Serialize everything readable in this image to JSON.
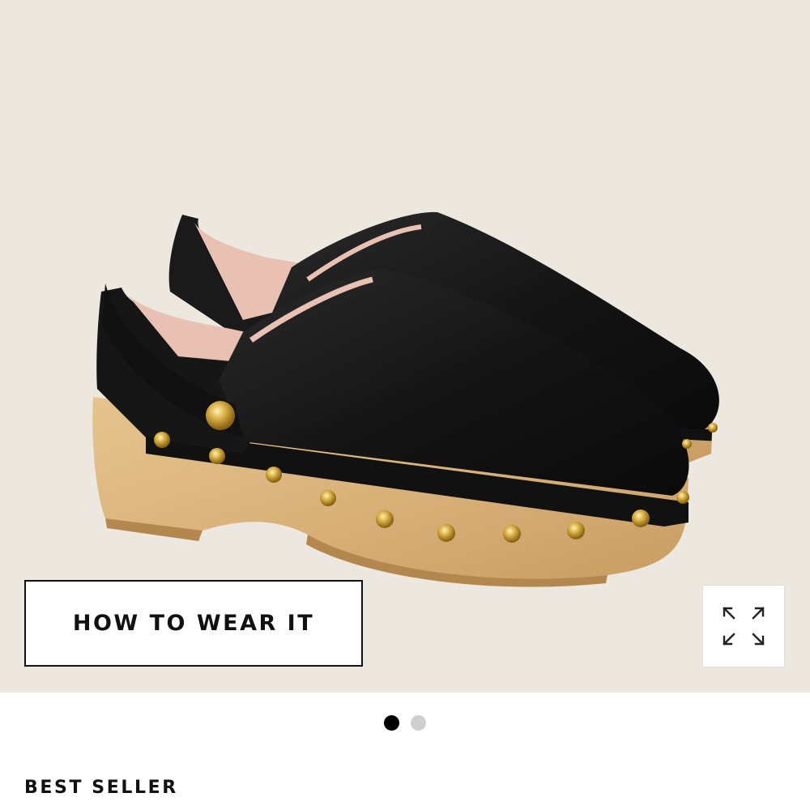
{
  "product_image": {
    "alt": "",
    "icon": "studded-clog-image"
  },
  "how_to_wear": {
    "label": "HOW TO WEAR IT"
  },
  "expand": {
    "icon": "expand-arrows-icon"
  },
  "carousel": {
    "current": 1,
    "total": 2
  },
  "badge": {
    "label": "BEST SELLER"
  },
  "colors": {
    "background": "#ece8df",
    "leather": "#151515",
    "wood": "#d9b37c",
    "stud": "#c9a13a",
    "lining": "#e9c1b3"
  }
}
